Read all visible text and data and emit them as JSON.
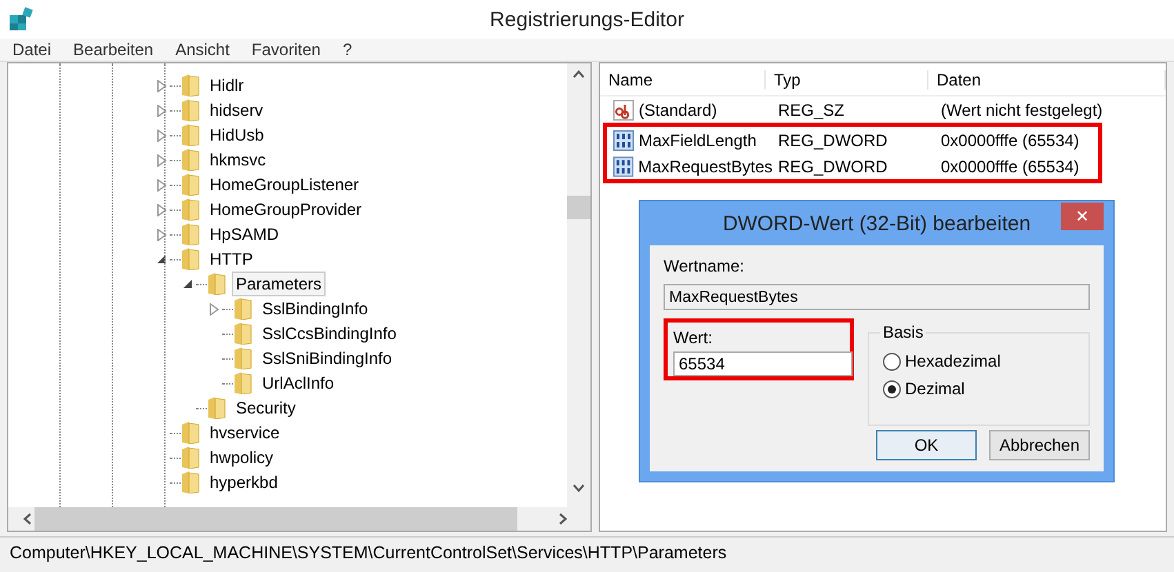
{
  "window": {
    "title": "Registrierungs-Editor"
  },
  "menu": [
    "Datei",
    "Bearbeiten",
    "Ansicht",
    "Favoriten",
    "?"
  ],
  "tree": [
    {
      "label": "Hidlr",
      "kind": "collapsed",
      "selected": false
    },
    {
      "label": "hidserv",
      "kind": "collapsed",
      "selected": false
    },
    {
      "label": "HidUsb",
      "kind": "collapsed",
      "selected": false
    },
    {
      "label": "hkmsvc",
      "kind": "collapsed",
      "selected": false
    },
    {
      "label": "HomeGroupListener",
      "kind": "collapsed",
      "selected": false
    },
    {
      "label": "HomeGroupProvider",
      "kind": "collapsed",
      "selected": false
    },
    {
      "label": "HpSAMD",
      "kind": "collapsed",
      "selected": false
    },
    {
      "label": "HTTP",
      "kind": "expanded",
      "selected": false,
      "children": [
        {
          "label": "Parameters",
          "kind": "expanded",
          "selected": true,
          "children": [
            {
              "label": "SslBindingInfo",
              "kind": "collapsed",
              "selected": false
            },
            {
              "label": "SslCcsBindingInfo",
              "kind": "leaf",
              "selected": false
            },
            {
              "label": "SslSniBindingInfo",
              "kind": "leaf",
              "selected": false
            },
            {
              "label": "UrlAclInfo",
              "kind": "leaf",
              "selected": false
            }
          ]
        },
        {
          "label": "Security",
          "kind": "leaf",
          "selected": false
        }
      ]
    },
    {
      "label": "hvservice",
      "kind": "leaf",
      "selected": false
    },
    {
      "label": "hwpolicy",
      "kind": "leaf",
      "selected": false
    },
    {
      "label": "hyperkbd",
      "kind": "leaf",
      "selected": false
    }
  ],
  "table": {
    "columns": [
      "Name",
      "Typ",
      "Daten"
    ],
    "rows": [
      {
        "kind": "string",
        "name": "(Standard)",
        "type": "REG_SZ",
        "data": "(Wert nicht festgelegt)",
        "highlighted": false
      },
      {
        "kind": "dword",
        "name": "MaxFieldLength",
        "type": "REG_DWORD",
        "data": "0x0000fffe (65534)",
        "highlighted": true
      },
      {
        "kind": "dword",
        "name": "MaxRequestBytes",
        "type": "REG_DWORD",
        "data": "0x0000fffe (65534)",
        "highlighted": true
      }
    ]
  },
  "dialog": {
    "title": "DWORD-Wert (32-Bit) bearbeiten",
    "close": "✕",
    "name_label": "Wertname:",
    "name_value": "MaxRequestBytes",
    "value_label": "Wert:",
    "value": "65534",
    "value_highlighted": true,
    "base_group": "Basis",
    "bases": [
      {
        "label": "Hexadezimal",
        "selected": false
      },
      {
        "label": "Dezimal",
        "selected": true
      }
    ],
    "buttons": [
      {
        "label": "OK",
        "default": true
      },
      {
        "label": "Abbrechen",
        "default": false
      }
    ]
  },
  "status_bar": "Computer\\HKEY_LOCAL_MACHINE\\SYSTEM\\CurrentControlSet\\Services\\HTTP\\Parameters"
}
